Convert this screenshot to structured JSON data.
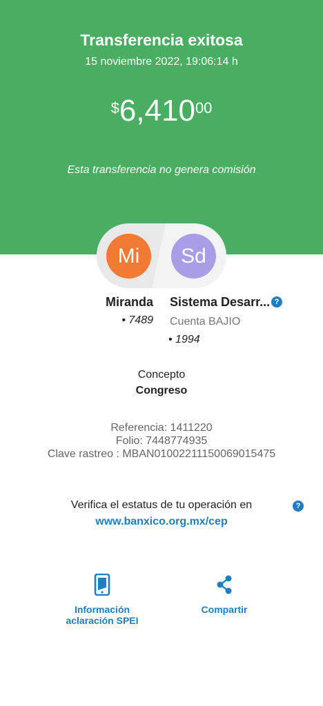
{
  "header": {
    "title": "Transferencia exitosa",
    "datetime": "15 noviembre 2022, 19:06:14 h",
    "amount": {
      "currency": "$",
      "integer": "6,410",
      "cents": "00"
    },
    "note": "Esta transferencia no genera comisión",
    "background_color": "#49ae62"
  },
  "sender": {
    "initials": "Mi",
    "name": "Miranda",
    "account": "• 7489",
    "avatar_color": "#f17b33"
  },
  "recipient": {
    "initials": "Sd",
    "name": "Sistema Desarr...",
    "bank": "Cuenta BAJIO",
    "account": "• 1994",
    "avatar_color": "#a99de6",
    "help_icon": "question-circle-icon"
  },
  "concept": {
    "label": "Concepto",
    "value": "Congreso"
  },
  "references": {
    "referencia": "Referencia: 1411220",
    "folio": "Folio: 7448774935",
    "clave_rastreo": "Clave rastreo : MBAN01002211150069015475"
  },
  "verify": {
    "text": "Verifica el estatus de tu operación en",
    "link": "www.banxico.org.mx/cep",
    "help_icon": "question-circle-icon",
    "link_color": "#1f7ec1"
  },
  "actions": {
    "info": {
      "line1": "Información",
      "line2": "aclaración SPEI",
      "icon": "phone-document-icon"
    },
    "share": {
      "label": "Compartir",
      "icon": "share-icon"
    }
  },
  "help_glyph": "?"
}
